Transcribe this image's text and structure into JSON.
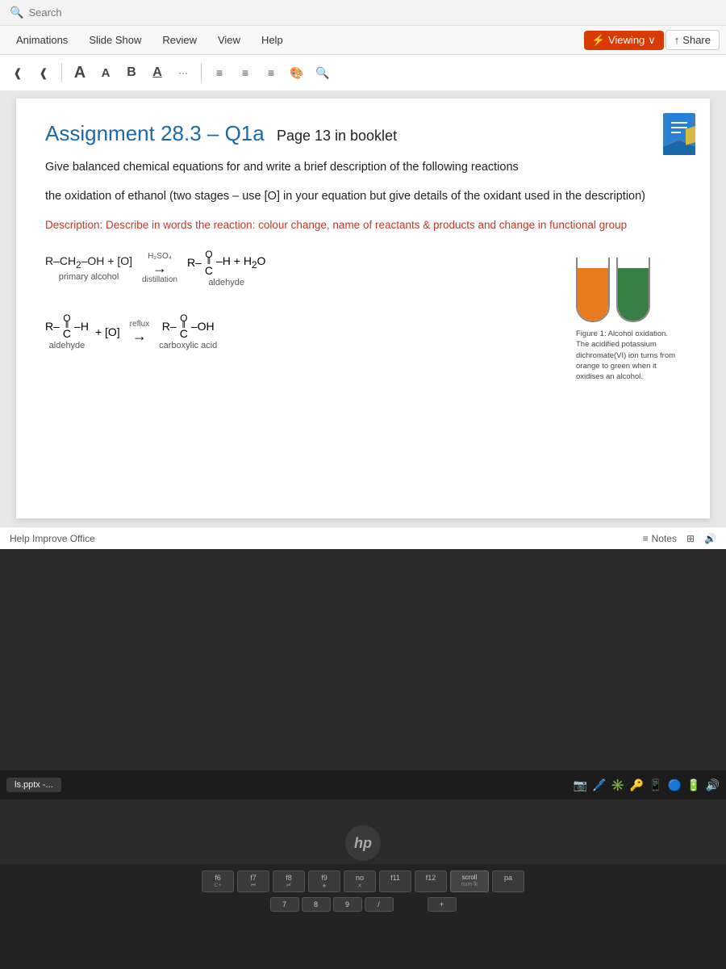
{
  "search": {
    "placeholder": "Search"
  },
  "ribbon": {
    "tabs": [
      {
        "label": "Animations",
        "active": false
      },
      {
        "label": "Slide Show",
        "active": true
      },
      {
        "label": "Review",
        "active": false
      },
      {
        "label": "View",
        "active": false
      },
      {
        "label": "Help",
        "active": false
      }
    ],
    "viewing_label": "Viewing",
    "share_label": "Share"
  },
  "toolbar": {
    "font_a_large": "A",
    "font_a_small": "A",
    "bold": "B",
    "underline_a": "A",
    "ellipsis": "···"
  },
  "slide": {
    "title": "Assignment 28.3 – Q1a",
    "page_ref": "Page 13 in booklet",
    "instruction1": "Give balanced chemical equations for and write a brief description of the following reactions",
    "instruction2": "the oxidation of ethanol (two stages – use [O] in your equation but give details of the oxidant used in the description)",
    "description": "Description: Describe in words the reaction: colour change, name of reactants & products and change in functional group",
    "eq1_left": "R–CH₂–OH + [O]",
    "eq1_condition1": "H₂SO₄",
    "eq1_condition2": "distillation",
    "eq1_right_formula": "R–C–H",
    "eq1_right_suffix": " + H₂O",
    "eq1_label": "aldehyde",
    "eq1_left_label": "primary alcohol",
    "eq2_left": "R–C–H",
    "eq2_left_label": "aldehyde",
    "eq2_condition": "reflux",
    "eq2_operator": "+ [O]",
    "eq2_right": "R–C–OH",
    "eq2_right_label": "carboxylic acid",
    "figure_caption": "Figure 1: Alcohol oxidation. The acidified potassium dichromate(VI) ion turns from orange to green when it oxidises an alcohol."
  },
  "status": {
    "help_improve": "Help Improve Office",
    "notes": "Notes"
  },
  "taskbar": {
    "item": "ls.pptx -..."
  },
  "keyboard": {
    "keys": [
      {
        "label": "f6",
        "sub": ""
      },
      {
        "label": "f7",
        "sub": ""
      },
      {
        "label": "f8",
        "sub": ""
      },
      {
        "label": "f9",
        "sub": ""
      },
      {
        "label": "no",
        "sub": ""
      },
      {
        "label": "f11",
        "sub": ""
      },
      {
        "label": "f12",
        "sub": ""
      },
      {
        "label": "scroll",
        "sub": "num lk"
      },
      {
        "label": "pa",
        "sub": ""
      }
    ]
  }
}
